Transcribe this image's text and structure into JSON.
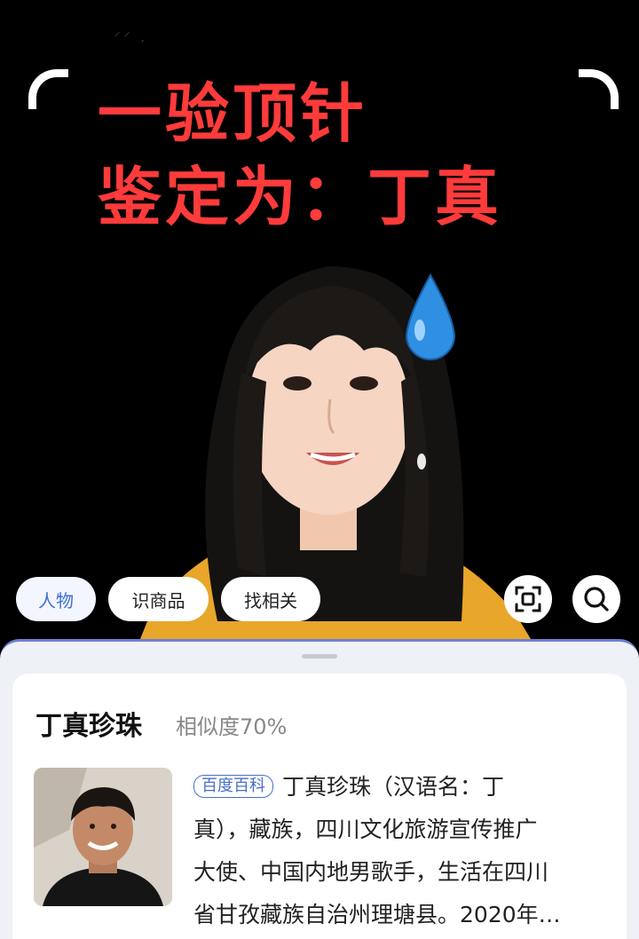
{
  "status_bar": {
    "fragment": "⸍⸍ ."
  },
  "overlay": {
    "headline_line1": "一验顶针",
    "headline_line2": "鉴定为：丁真",
    "headline_color": "#ff3b3b"
  },
  "chips": [
    {
      "label": "人物",
      "active": true
    },
    {
      "label": "识商品",
      "active": false
    },
    {
      "label": "找相关",
      "active": false
    }
  ],
  "buttons": {
    "scan_icon": "scan-frame-icon",
    "search_icon": "search-icon"
  },
  "result": {
    "name": "丁真珍珠",
    "similarity": "相似度70%",
    "source_badge": "百度百科",
    "description_lines": [
      "丁真珍珠（汉语名：丁",
      "真），藏族，四川文化旅游宣传推广",
      "大使、中国内地男歌手，生活在四川",
      "省甘孜藏族自治州理塘县。2020年…"
    ]
  },
  "colors": {
    "accent": "#3d6fd8",
    "sheet_border": "#6f7fd0"
  }
}
